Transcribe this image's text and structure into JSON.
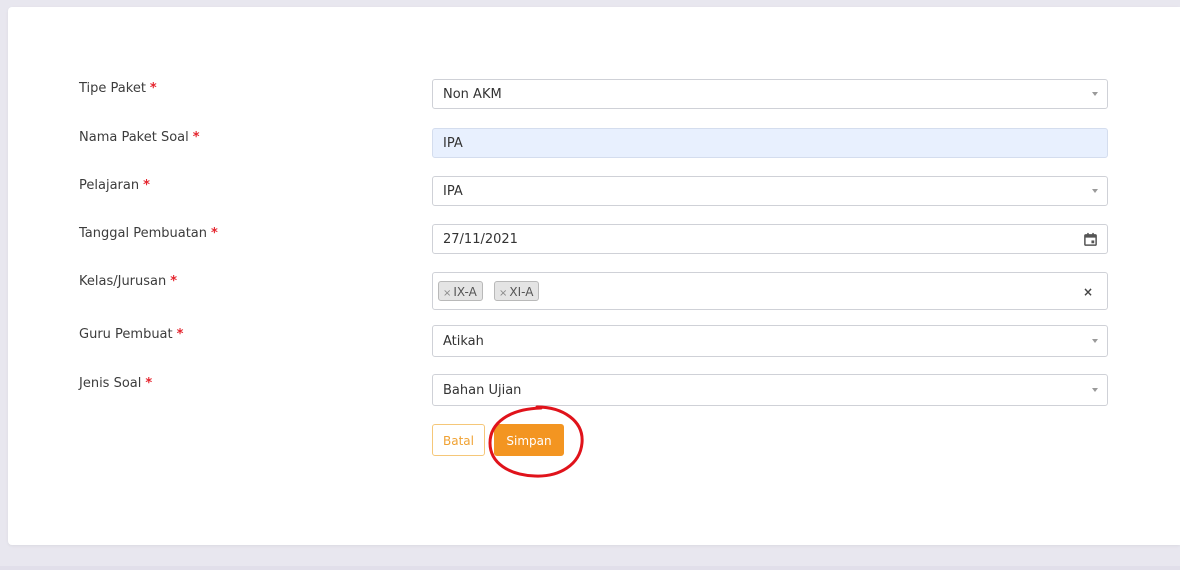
{
  "form": {
    "required_mark": "*",
    "fields": {
      "tipe_paket": {
        "label": "Tipe Paket",
        "value": "Non AKM"
      },
      "nama_paket": {
        "label": "Nama Paket Soal",
        "value": "IPA"
      },
      "pelajaran": {
        "label": "Pelajaran",
        "value": "IPA"
      },
      "tanggal": {
        "label": "Tanggal Pembuatan",
        "value": "27/11/2021"
      },
      "kelas": {
        "label": "Kelas/Jurusan",
        "tags": [
          "IX-A",
          "XI-A"
        ],
        "tag_remove": "×",
        "clear": "×"
      },
      "guru": {
        "label": "Guru Pembuat",
        "value": "Atikah"
      },
      "jenis": {
        "label": "Jenis Soal",
        "value": "Bahan Ujian"
      }
    },
    "buttons": {
      "cancel": "Batal",
      "save": "Simpan"
    }
  },
  "colors": {
    "accent": "#f39521",
    "required": "#e5252e",
    "annotation": "#e0131b"
  },
  "icons": {
    "caret": "chevron-down-icon",
    "calendar": "calendar-icon"
  }
}
